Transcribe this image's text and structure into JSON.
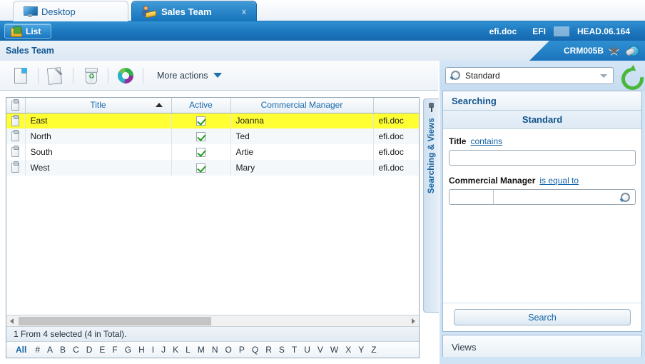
{
  "tabs": [
    {
      "label": "Desktop",
      "icon": "monitor-icon",
      "active": false
    },
    {
      "label": "Sales Team",
      "icon": "sales-team-icon",
      "active": true,
      "close": "x"
    }
  ],
  "bluebar": {
    "list_button": "List",
    "user": "efi.doc",
    "org": "EFI",
    "version": "HEAD.06.164"
  },
  "breadcrumb": {
    "title": "Sales Team",
    "code": "CRM005B",
    "star_icon": "star-icon",
    "globe_icon": "globe-icon"
  },
  "toolbar": {
    "new_icon": "new-document-icon",
    "edit_icon": "edit-document-icon",
    "delete_icon": "delete-trash-icon",
    "refresh_icon": "refresh-icon",
    "more_actions": "More actions"
  },
  "grid": {
    "columns": [
      "",
      "Title",
      "Active",
      "Commercial Manager",
      ""
    ],
    "sort_column": "Title",
    "sort_direction": "asc",
    "rows": [
      {
        "title": "East",
        "active": true,
        "manager": "Joanna",
        "doc": "efi.doc",
        "selected": true
      },
      {
        "title": "North",
        "active": true,
        "manager": "Ted",
        "doc": "efi.doc",
        "selected": false
      },
      {
        "title": "South",
        "active": true,
        "manager": "Artie",
        "doc": "efi.doc",
        "selected": false
      },
      {
        "title": "West",
        "active": true,
        "manager": "Mary",
        "doc": "efi.doc",
        "selected": false
      }
    ],
    "status": "1 From 4 selected (4 in Total).",
    "alphabet": [
      "All",
      "#",
      "A",
      "B",
      "C",
      "D",
      "E",
      "F",
      "G",
      "H",
      "I",
      "J",
      "K",
      "L",
      "M",
      "N",
      "O",
      "P",
      "Q",
      "R",
      "S",
      "T",
      "U",
      "V",
      "W",
      "X",
      "Y",
      "Z"
    ]
  },
  "vtab": {
    "label": "Searching & Views",
    "pin_icon": "pin-icon"
  },
  "rightpanel": {
    "selector_value": "Standard",
    "selector_icon": "magnifier-icon",
    "refresh_icon": "refresh-green-icon",
    "section_title": "Searching",
    "sub_title": "Standard",
    "fields": [
      {
        "label": "Title",
        "operator": "contains",
        "value": "",
        "type": "text"
      },
      {
        "label": "Commercial Manager",
        "operator": "is equal to",
        "value": "",
        "type": "lookup"
      }
    ],
    "search_button": "Search",
    "views_label": "Views"
  },
  "colors": {
    "accent_blue": "#1c76bd",
    "selection_yellow": "#ffff33",
    "link_blue": "#1565a8",
    "panel_blue": "#cfe3f4",
    "check_green": "#1f9c1f"
  }
}
